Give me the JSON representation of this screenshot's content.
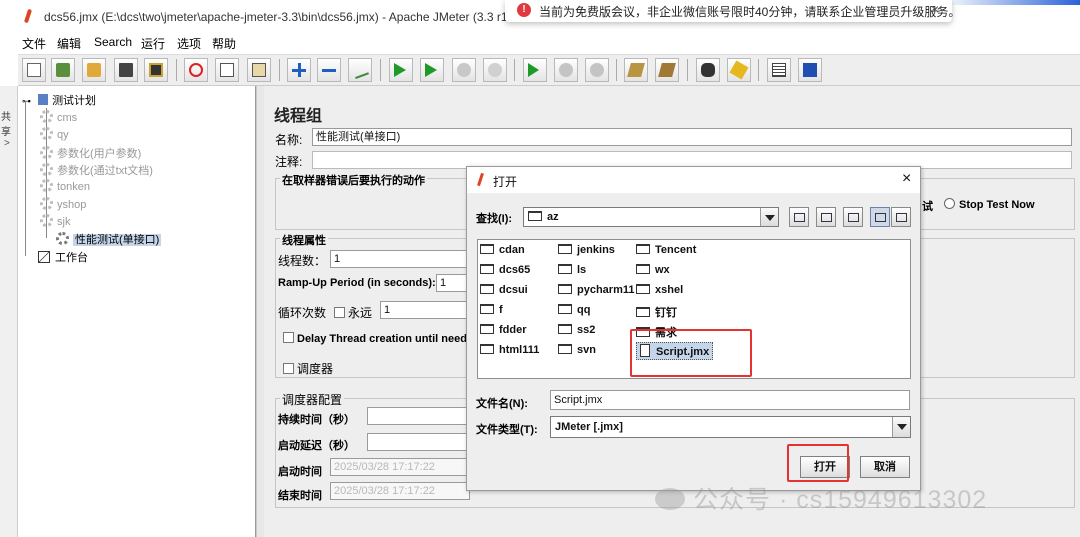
{
  "window": {
    "title": "dcs56.jmx (E:\\dcs\\two\\jmeter\\apache-jmeter-3.3\\bin\\dcs56.jmx) - Apache JMeter (3.3 r1"
  },
  "notice": {
    "text": "当前为免费版会议，非企业微信账号限时40分钟，请联系企业管理员升级服务。",
    "close": "×"
  },
  "menu": [
    "文件",
    "编辑",
    "Search",
    "运行",
    "选项",
    "帮助"
  ],
  "left_strip": {
    "a": "共享",
    "b": ">"
  },
  "tree": {
    "root": "测试计划",
    "items": [
      "cms",
      "qy",
      "参数化(用户参数)",
      "参数化(通过txt文档)",
      "tonken",
      "yshop",
      "sjk"
    ],
    "selected": "性能测试(单接口)",
    "workbench": "工作台"
  },
  "panel": {
    "title": "线程组",
    "name_label": "名称:",
    "name_value": "性能测试(单接口)",
    "comment_label": "注释:",
    "error_group": "在取样器错误后要执行的动作",
    "radio_partial": "试",
    "stop_now": "Stop Test Now",
    "thread_group": "线程属性",
    "threads_label": "线程数：",
    "threads_value": "1",
    "rampup_label": "Ramp-Up Period (in seconds):",
    "rampup_value": "1",
    "loop_label": "循环次数",
    "forever_label": "永远",
    "loop_value": "1",
    "delay_label": "Delay Thread creation until need",
    "scheduler_label": "调度器",
    "scheduler_group": "调度器配置",
    "duration_label": "持续时间（秒）",
    "startup_delay_label": "启动延迟（秒）",
    "start_time_label": "启动时间",
    "start_time_value": "2025/03/28 17:17:22",
    "end_time_label": "结束时间",
    "end_time_value": "2025/03/28 17:17:22"
  },
  "dialog": {
    "title": "打开",
    "close": "×",
    "lookin_label": "查找(I):",
    "lookin_value": "az",
    "files": [
      [
        "cdan",
        "jenkins",
        "Tencent"
      ],
      [
        "dcs65",
        "ls",
        "wx"
      ],
      [
        "dcsui",
        "pycharm11",
        "xshel"
      ],
      [
        "f",
        "qq",
        "钉钉"
      ],
      [
        "fdder",
        "ss2",
        "需求"
      ],
      [
        "html111",
        "svn",
        "Script.jmx"
      ]
    ],
    "filename_label": "文件名(N):",
    "filename_value": "Script.jmx",
    "filetype_label": "文件类型(T):",
    "filetype_value": "JMeter [.jmx]",
    "open_button": "打开",
    "cancel_button": "取消"
  },
  "watermark": "公众号 · cs15949613302",
  "colors": {
    "highlight": "#e53333",
    "selection": "#c5d5ea",
    "error_icon": "#e0393e"
  }
}
